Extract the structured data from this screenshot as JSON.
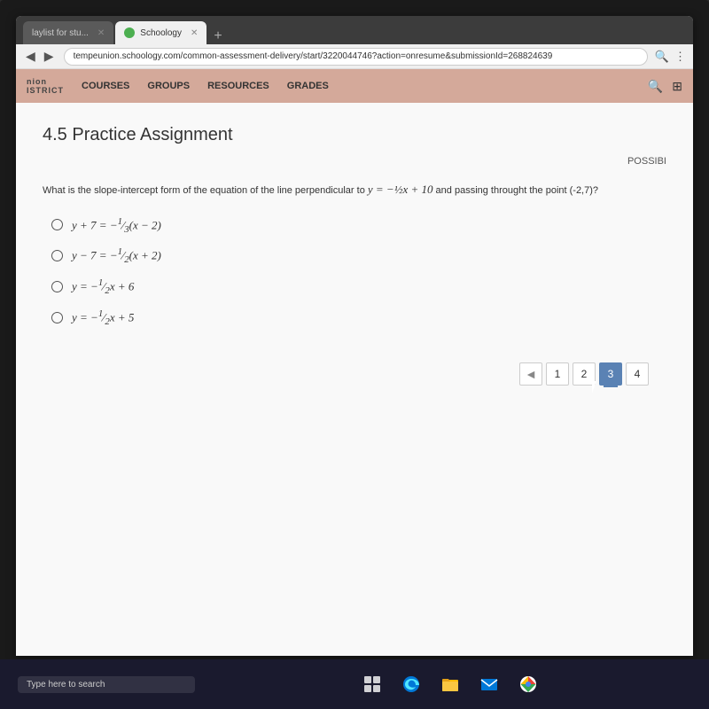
{
  "browser": {
    "tabs": [
      {
        "id": "tab1",
        "label": "laylist for stu...",
        "active": false,
        "has_close": true
      },
      {
        "id": "tab2",
        "label": "Schoology",
        "active": true,
        "has_close": true,
        "icon": "schoology-favicon"
      }
    ],
    "new_tab_label": "+",
    "address": "tempeunion.schoology.com/common-assessment-delivery/start/3220044746?action=onresume&submissionId=268824639",
    "nav": {
      "back": "◀",
      "forward": "▶"
    }
  },
  "schoology_nav": {
    "logo": "nion",
    "logo_sub": "ISTRICT",
    "links": [
      {
        "id": "courses",
        "label": "COURSES"
      },
      {
        "id": "groups",
        "label": "GROUPS"
      },
      {
        "id": "resources",
        "label": "RESOURCES"
      },
      {
        "id": "grades",
        "label": "GRADES"
      }
    ],
    "search_icon": "🔍",
    "grid_icon": "⊞"
  },
  "assignment": {
    "title": "4.5 Practice Assignment",
    "possible_points_label": "POSSIBI",
    "question": "What is the slope-intercept form of the equation of the line perpendicular to y = −½x + 10 and passing throught the point (-2,7)?",
    "choices": [
      {
        "id": "A",
        "math": "y + 7 = −⅓(x − 2)"
      },
      {
        "id": "B",
        "math": "y − 7 = −½(x + 2)"
      },
      {
        "id": "C",
        "math": "y = −½x + 6"
      },
      {
        "id": "D",
        "math": "y = −½x + 5"
      }
    ]
  },
  "pagination": {
    "prev_label": "◄",
    "pages": [
      "1",
      "2",
      "3",
      "4"
    ],
    "active_page": "3"
  },
  "taskbar": {
    "search_placeholder": "Type here to search",
    "icons": [
      {
        "id": "taskview",
        "label": "task-view-icon"
      },
      {
        "id": "edge",
        "label": "edge-icon"
      },
      {
        "id": "explorer",
        "label": "file-explorer-icon"
      },
      {
        "id": "mail",
        "label": "mail-icon"
      },
      {
        "id": "chrome",
        "label": "chrome-icon"
      }
    ]
  }
}
